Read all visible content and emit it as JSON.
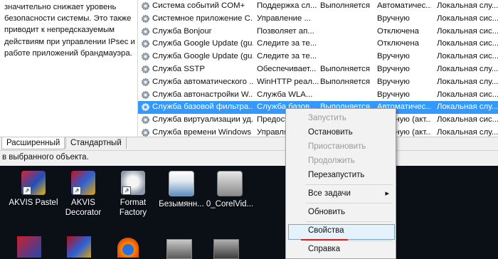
{
  "description": {
    "lines": [
      "значительно снижает уровень",
      "безопасности системы. Это также",
      "приводит к непредсказуемым",
      "действиям при управлении IPsec и",
      "работе приложений брандмауэра."
    ]
  },
  "services": [
    {
      "name": "Система событий COM+",
      "desc": "Поддержка сл...",
      "status": "Выполняется",
      "startup": "Автоматичес...",
      "logon": "Локальная слу..."
    },
    {
      "name": "Системное приложение С...",
      "desc": "Управление ...",
      "status": "",
      "startup": "Вручную",
      "logon": "Локальная сис..."
    },
    {
      "name": "Служба Bonjour",
      "desc": "Позволяет ап...",
      "status": "",
      "startup": "Отключена",
      "logon": "Локальная сис..."
    },
    {
      "name": "Служба Google Update (gu...",
      "desc": "Следите за те...",
      "status": "",
      "startup": "Отключена",
      "logon": "Локальная сис..."
    },
    {
      "name": "Служба Google Update (gu...",
      "desc": "Следите за те...",
      "status": "",
      "startup": "Вручную",
      "logon": "Локальная сис..."
    },
    {
      "name": "Служба SSTP",
      "desc": "Обеспечивает...",
      "status": "Выполняется",
      "startup": "Вручную",
      "logon": "Локальная слу..."
    },
    {
      "name": "Служба автоматического ...",
      "desc": "WinHTTP реал...",
      "status": "Выполняется",
      "startup": "Вручную",
      "logon": "Локальная слу..."
    },
    {
      "name": "Служба автонастройки W...",
      "desc": "Служба WLA...",
      "status": "",
      "startup": "Вручную",
      "logon": "Локальная сис..."
    },
    {
      "name": "Служба базовой фильтра...",
      "desc": "Служба базов...",
      "status": "Выполняется",
      "startup": "Автоматичес...",
      "logon": "Локальная слу..."
    },
    {
      "name": "Служба виртуализации уд...",
      "desc": "Предоставля...",
      "status": "",
      "startup": "Вручную (акт...",
      "logon": "Локальная сис..."
    },
    {
      "name": "Служба времени Windows",
      "desc": "Управляет с...",
      "status": "",
      "startup": "Вручную (акт...",
      "logon": "Локальная слу..."
    }
  ],
  "tabs": {
    "extended": "Расширенный",
    "standard": "Стандартный"
  },
  "status_bar": {
    "text": "в выбранного объекта."
  },
  "desktop_icons": [
    {
      "line1": "AKVIS Pastel",
      "line2": ""
    },
    {
      "line1": "AKVIS",
      "line2": "Decorator"
    },
    {
      "line1": "Format",
      "line2": "Factory"
    },
    {
      "line1": "Безымянн...",
      "line2": ""
    },
    {
      "line1": "0_CorelVid...",
      "line2": ""
    }
  ],
  "context_menu": {
    "start": "Запустить",
    "stop": "Остановить",
    "pause": "Приостановить",
    "resume": "Продолжить",
    "restart": "Перезапустить",
    "all_tasks": "Все задачи",
    "all_tasks_arrow": "▸",
    "refresh": "Обновить",
    "properties": "Свойства",
    "help": "Справка"
  },
  "colors": {
    "selection": "#3399ff",
    "highlight_underline": "#e31d1d"
  }
}
